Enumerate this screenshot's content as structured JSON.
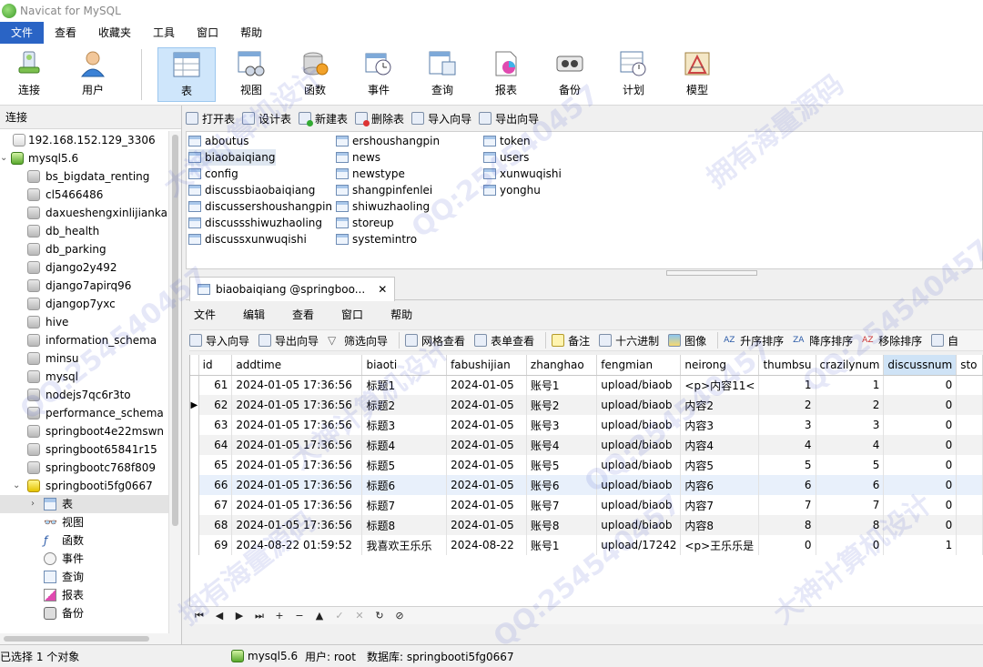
{
  "window": {
    "title": "Navicat for MySQL"
  },
  "menubar": [
    "文件",
    "查看",
    "收藏夹",
    "工具",
    "窗口",
    "帮助"
  ],
  "ribbon": [
    {
      "label": "连接",
      "icon": "connection-icon"
    },
    {
      "label": "用户",
      "icon": "user-icon"
    },
    {
      "label": "表",
      "icon": "table-icon",
      "active": true
    },
    {
      "label": "视图",
      "icon": "view-icon"
    },
    {
      "label": "函数",
      "icon": "function-icon"
    },
    {
      "label": "事件",
      "icon": "event-icon"
    },
    {
      "label": "查询",
      "icon": "query-icon"
    },
    {
      "label": "报表",
      "icon": "report-icon"
    },
    {
      "label": "备份",
      "icon": "backup-icon"
    },
    {
      "label": "计划",
      "icon": "schedule-icon"
    },
    {
      "label": "模型",
      "icon": "model-icon"
    }
  ],
  "left_panel": {
    "header": "连接",
    "tree": [
      {
        "label": "192.168.152.129_3306",
        "type": "connection"
      },
      {
        "label": "mysql5.6",
        "type": "connection-open"
      },
      {
        "label": "bs_bigdata_renting",
        "type": "db"
      },
      {
        "label": "cl5466486",
        "type": "db"
      },
      {
        "label": "daxueshengxinlijiankang",
        "type": "db"
      },
      {
        "label": "db_health",
        "type": "db"
      },
      {
        "label": "db_parking",
        "type": "db"
      },
      {
        "label": "django2y492",
        "type": "db"
      },
      {
        "label": "django7apirq96",
        "type": "db"
      },
      {
        "label": "djangop7yxc",
        "type": "db"
      },
      {
        "label": "hive",
        "type": "db"
      },
      {
        "label": "information_schema",
        "type": "db"
      },
      {
        "label": "minsu",
        "type": "db"
      },
      {
        "label": "mysql",
        "type": "db"
      },
      {
        "label": "nodejs7qc6r3to",
        "type": "db"
      },
      {
        "label": "performance_schema",
        "type": "db"
      },
      {
        "label": "springboot4e22mswn",
        "type": "db"
      },
      {
        "label": "springboot65841r15",
        "type": "db"
      },
      {
        "label": "springbootc768f809",
        "type": "db"
      },
      {
        "label": "springbooti5fg0667",
        "type": "db-open"
      },
      {
        "label": "表",
        "type": "tables"
      },
      {
        "label": "视图",
        "type": "views"
      },
      {
        "label": "函数",
        "type": "functions"
      },
      {
        "label": "事件",
        "type": "events"
      },
      {
        "label": "查询",
        "type": "queries"
      },
      {
        "label": "报表",
        "type": "reports"
      },
      {
        "label": "备份",
        "type": "backups"
      }
    ]
  },
  "object_toolbar": [
    "打开表",
    "设计表",
    "新建表",
    "删除表",
    "导入向导",
    "导出向导"
  ],
  "tables": [
    "aboutus",
    "biaobaiqiang",
    "config",
    "discussbiaobaiqiang",
    "discussershoushangpin",
    "discussshiwuzhaoling",
    "discussxunwuqishi",
    "ershoushangpin",
    "news",
    "newstype",
    "shangpinfenlei",
    "shiwuzhaoling",
    "storeup",
    "systemintro",
    "token",
    "users",
    "xunwuqishi",
    "yonghu"
  ],
  "tab": {
    "label": "biaobaiqiang @springboo...",
    "close": "✕"
  },
  "inner_menu": [
    "文件",
    "编辑",
    "查看",
    "窗口",
    "帮助"
  ],
  "data_toolbar": [
    "导入向导",
    "导出向导",
    "筛选向导",
    "网格查看",
    "表单查看",
    "备注",
    "十六进制",
    "图像",
    "升序排序",
    "降序排序",
    "移除排序",
    "自"
  ],
  "grid": {
    "columns": [
      "id",
      "addtime",
      "biaoti",
      "fabushijian",
      "zhanghao",
      "fengmian",
      "neirong",
      "thumbsu",
      "crazilynum",
      "discussnum",
      "sto"
    ],
    "rows": [
      [
        "61",
        "2024-01-05 17:36:56",
        "标题1",
        "2024-01-05",
        "账号1",
        "upload/biaob",
        "<p>内容11<",
        "1",
        "1",
        "0"
      ],
      [
        "62",
        "2024-01-05 17:36:56",
        "标题2",
        "2024-01-05",
        "账号2",
        "upload/biaob",
        "内容2",
        "2",
        "2",
        "0"
      ],
      [
        "63",
        "2024-01-05 17:36:56",
        "标题3",
        "2024-01-05",
        "账号3",
        "upload/biaob",
        "内容3",
        "3",
        "3",
        "0"
      ],
      [
        "64",
        "2024-01-05 17:36:56",
        "标题4",
        "2024-01-05",
        "账号4",
        "upload/biaob",
        "内容4",
        "4",
        "4",
        "0"
      ],
      [
        "65",
        "2024-01-05 17:36:56",
        "标题5",
        "2024-01-05",
        "账号5",
        "upload/biaob",
        "内容5",
        "5",
        "5",
        "0"
      ],
      [
        "66",
        "2024-01-05 17:36:56",
        "标题6",
        "2024-01-05",
        "账号6",
        "upload/biaob",
        "内容6",
        "6",
        "6",
        "0"
      ],
      [
        "67",
        "2024-01-05 17:36:56",
        "标题7",
        "2024-01-05",
        "账号7",
        "upload/biaob",
        "内容7",
        "7",
        "7",
        "0"
      ],
      [
        "68",
        "2024-01-05 17:36:56",
        "标题8",
        "2024-01-05",
        "账号8",
        "upload/biaob",
        "内容8",
        "8",
        "8",
        "0"
      ],
      [
        "69",
        "2024-08-22 01:59:52",
        "我喜欢王乐乐",
        "2024-08-22",
        "账号1",
        "upload/17242",
        "<p>王乐乐是",
        "0",
        "0",
        "1"
      ]
    ]
  },
  "navbar": [
    "⏮",
    "◀",
    "▶",
    "⏭",
    "+",
    "−",
    "▲",
    "✓",
    "✕",
    "↻",
    "⊘"
  ],
  "status": {
    "selection": "已选择 1 个对象",
    "connection": "mysql5.6",
    "user": "用户: root",
    "database": "数据库: springbooti5fg0667"
  },
  "watermark": [
    "大神计算机设计",
    "QQ:254540457",
    "拥有海量源码"
  ]
}
